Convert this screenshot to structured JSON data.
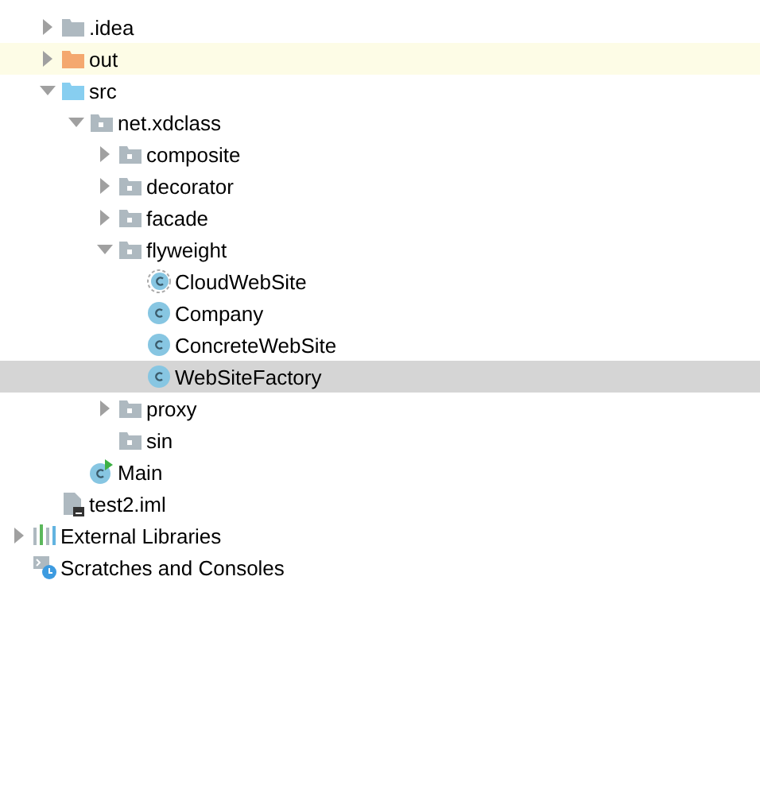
{
  "project_tree": [
    {
      "label": ".idea",
      "kind": "folder",
      "expanded": false,
      "selected": false,
      "excluded": false
    },
    {
      "label": "out",
      "kind": "excluded-folder",
      "expanded": false,
      "selected": false,
      "excluded": true
    },
    {
      "label": "src",
      "kind": "source-folder",
      "expanded": true,
      "selected": false,
      "excluded": false,
      "children": [
        {
          "label": "net.xdclass",
          "kind": "package",
          "expanded": true,
          "selected": false,
          "excluded": false,
          "children": [
            {
              "label": "composite",
              "kind": "package",
              "expanded": false,
              "selected": false,
              "excluded": false
            },
            {
              "label": "decorator",
              "kind": "package",
              "expanded": false,
              "selected": false,
              "excluded": false
            },
            {
              "label": "facade",
              "kind": "package",
              "expanded": false,
              "selected": false,
              "excluded": false
            },
            {
              "label": "flyweight",
              "kind": "package",
              "expanded": true,
              "selected": false,
              "excluded": false,
              "children": [
                {
                  "label": "CloudWebSite",
                  "kind": "abstract-class",
                  "selected": false,
                  "excluded": false
                },
                {
                  "label": "Company",
                  "kind": "class",
                  "selected": false,
                  "excluded": false
                },
                {
                  "label": "ConcreteWebSite",
                  "kind": "class",
                  "selected": false,
                  "excluded": false
                },
                {
                  "label": "WebSiteFactory",
                  "kind": "class",
                  "selected": true,
                  "excluded": false
                }
              ]
            },
            {
              "label": "proxy",
              "kind": "package",
              "expanded": false,
              "selected": false,
              "excluded": false
            },
            {
              "label": "sin",
              "kind": "package",
              "selected": false,
              "excluded": false
            }
          ]
        },
        {
          "label": "Main",
          "kind": "main-class",
          "selected": false,
          "excluded": false
        }
      ]
    },
    {
      "label": "test2.iml",
      "kind": "module-file",
      "selected": false,
      "excluded": false
    }
  ],
  "root_items": [
    {
      "label": "External Libraries",
      "kind": "libraries",
      "expanded": false,
      "selected": false,
      "excluded": false
    },
    {
      "label": "Scratches and Consoles",
      "kind": "scratches",
      "selected": false,
      "excluded": false
    }
  ]
}
